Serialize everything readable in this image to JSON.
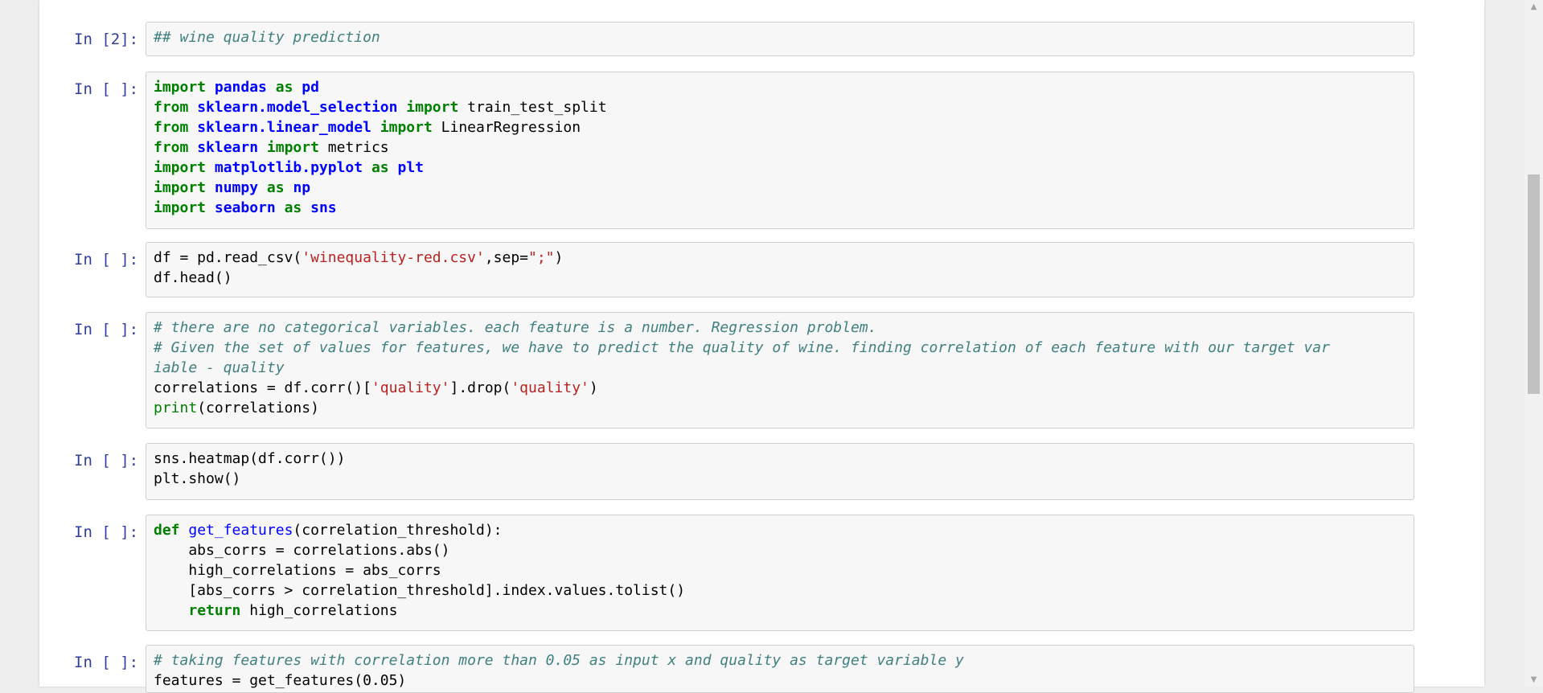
{
  "notebook": {
    "cells": [
      {
        "prompt": "In [2]:",
        "lines": [
          [
            {
              "t": "## wine quality prediction",
              "c": "cm"
            }
          ]
        ]
      },
      {
        "prompt": "In [ ]:",
        "lines": [
          [
            {
              "t": "import",
              "c": "kw"
            },
            {
              "t": " "
            },
            {
              "t": "pandas",
              "c": "nn"
            },
            {
              "t": " "
            },
            {
              "t": "as",
              "c": "kw"
            },
            {
              "t": " "
            },
            {
              "t": "pd",
              "c": "nn"
            }
          ],
          [
            {
              "t": "from",
              "c": "kw"
            },
            {
              "t": " "
            },
            {
              "t": "sklearn.model_selection",
              "c": "nn"
            },
            {
              "t": " "
            },
            {
              "t": "import",
              "c": "kw"
            },
            {
              "t": " train_test_split"
            }
          ],
          [
            {
              "t": "from",
              "c": "kw"
            },
            {
              "t": " "
            },
            {
              "t": "sklearn.linear_model",
              "c": "nn"
            },
            {
              "t": " "
            },
            {
              "t": "import",
              "c": "kw"
            },
            {
              "t": " LinearRegression"
            }
          ],
          [
            {
              "t": "from",
              "c": "kw"
            },
            {
              "t": " "
            },
            {
              "t": "sklearn",
              "c": "nn"
            },
            {
              "t": " "
            },
            {
              "t": "import",
              "c": "kw"
            },
            {
              "t": " metrics"
            }
          ],
          [
            {
              "t": "import",
              "c": "kw"
            },
            {
              "t": " "
            },
            {
              "t": "matplotlib.pyplot",
              "c": "nn"
            },
            {
              "t": " "
            },
            {
              "t": "as",
              "c": "kw"
            },
            {
              "t": " "
            },
            {
              "t": "plt",
              "c": "nn"
            }
          ],
          [
            {
              "t": "import",
              "c": "kw"
            },
            {
              "t": " "
            },
            {
              "t": "numpy",
              "c": "nn"
            },
            {
              "t": " "
            },
            {
              "t": "as",
              "c": "kw"
            },
            {
              "t": " "
            },
            {
              "t": "np",
              "c": "nn"
            }
          ],
          [
            {
              "t": "import",
              "c": "kw"
            },
            {
              "t": " "
            },
            {
              "t": "seaborn",
              "c": "nn"
            },
            {
              "t": " "
            },
            {
              "t": "as",
              "c": "kw"
            },
            {
              "t": " "
            },
            {
              "t": "sns",
              "c": "nn"
            }
          ]
        ]
      },
      {
        "prompt": "In [ ]:",
        "lines": [
          [
            {
              "t": "df = pd.read_csv("
            },
            {
              "t": "'winequality-red.csv'",
              "c": "st"
            },
            {
              "t": ",sep="
            },
            {
              "t": "\";\"",
              "c": "st"
            },
            {
              "t": ")"
            }
          ],
          [
            {
              "t": "df.head()"
            }
          ]
        ]
      },
      {
        "prompt": "In [ ]:",
        "lines": [
          [
            {
              "t": "# there are no categorical variables. each feature is a number. Regression problem.",
              "c": "cm"
            }
          ],
          [
            {
              "t": "# Given the set of values for features, we have to predict the quality of wine. finding correlation of each feature with our target var",
              "c": "cm"
            }
          ],
          [
            {
              "t": "iable - quality",
              "c": "cm"
            }
          ],
          [
            {
              "t": "correlations = df.corr()["
            },
            {
              "t": "'quality'",
              "c": "st"
            },
            {
              "t": "].drop("
            },
            {
              "t": "'quality'",
              "c": "st"
            },
            {
              "t": ")"
            }
          ],
          [
            {
              "t": "print",
              "c": "bi"
            },
            {
              "t": "(correlations)"
            }
          ]
        ]
      },
      {
        "prompt": "In [ ]:",
        "lines": [
          [
            {
              "t": "sns.heatmap(df.corr())"
            }
          ],
          [
            {
              "t": "plt.show()"
            }
          ]
        ]
      },
      {
        "prompt": "In [ ]:",
        "lines": [
          [
            {
              "t": "def",
              "c": "kw"
            },
            {
              "t": " "
            },
            {
              "t": "get_features",
              "c": "fn"
            },
            {
              "t": "(correlation_threshold):"
            }
          ],
          [
            {
              "t": "    abs_corrs = correlations.abs()"
            }
          ],
          [
            {
              "t": "    high_correlations = abs_corrs"
            }
          ],
          [
            {
              "t": "    [abs_corrs > correlation_threshold].index.values.tolist()"
            }
          ],
          [
            {
              "t": "    "
            },
            {
              "t": "return",
              "c": "kw"
            },
            {
              "t": " high_correlations"
            }
          ]
        ]
      },
      {
        "prompt": "In [ ]:",
        "lines": [
          [
            {
              "t": "# taking features with correlation more than 0.05 as input x and quality as target variable y",
              "c": "cm"
            }
          ],
          [
            {
              "t": "features = get_features(0.05)"
            }
          ]
        ]
      }
    ]
  },
  "scrollbar": {
    "up_arrow": "▲",
    "down_arrow": "▼"
  }
}
